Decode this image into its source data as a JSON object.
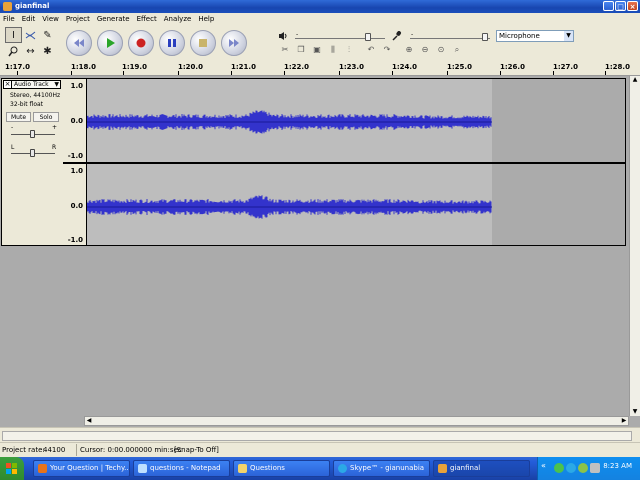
{
  "window": {
    "title": "gianfinal"
  },
  "menu": [
    "File",
    "Edit",
    "View",
    "Project",
    "Generate",
    "Effect",
    "Analyze",
    "Help"
  ],
  "mixer": {
    "input_source": "Microphone"
  },
  "ruler": {
    "ticks": [
      "1:17.0",
      "1:18.0",
      "1:19.0",
      "1:20.0",
      "1:21.0",
      "1:22.0",
      "1:23.0",
      "1:24.0",
      "1:25.0",
      "1:26.0",
      "1:27.0",
      "1:28.0"
    ]
  },
  "track": {
    "name": "Audio Track",
    "info_line1": "Stereo, 44100Hz",
    "info_line2": "32-bit float",
    "mute_label": "Mute",
    "solo_label": "Solo",
    "gain_minus": "-",
    "gain_plus": "+",
    "pan_left": "L",
    "pan_right": "R",
    "scale": [
      "1.0",
      "0.0",
      "-1.0"
    ]
  },
  "status": {
    "project_rate_label": "Project rate:",
    "project_rate_value": "44100",
    "cursor": "Cursor: 0:00.000000 min:sec",
    "snap": "[Snap-To Off]"
  },
  "taskbar": {
    "tasks": [
      {
        "label": "Your Question | Techy...",
        "color": "#e8731a"
      },
      {
        "label": "questions - Notepad",
        "color": "#bfe0ff"
      },
      {
        "label": "Questions",
        "color": "#f2d36b"
      },
      {
        "label": "Skype™ - gianunabia",
        "color": "#2ba9e6"
      },
      {
        "label": "gianfinal",
        "color": "#e8a23a"
      }
    ],
    "clock": "8:23 AM"
  },
  "colors": {
    "waveform": "#3333cc",
    "waveform_dark": "#1a1a99",
    "selection_bg": "#bdbdbd"
  }
}
